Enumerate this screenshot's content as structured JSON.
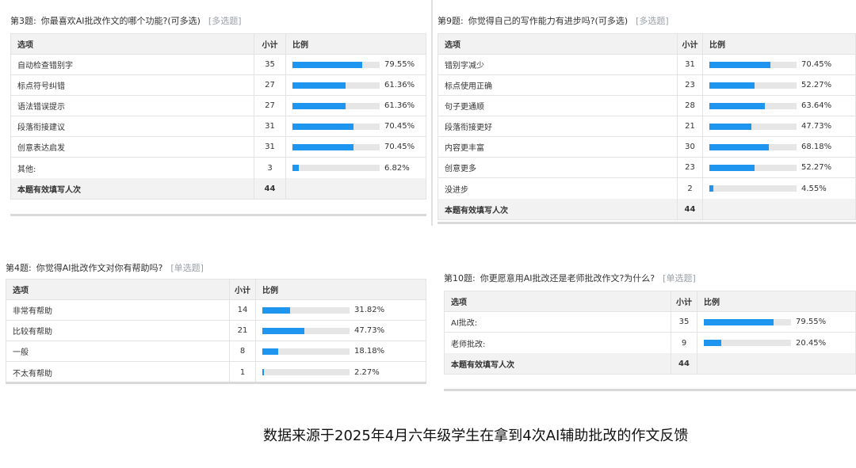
{
  "headers": {
    "option": "选项",
    "count": "小计",
    "ratio": "比例"
  },
  "q3": {
    "number": "第3题:",
    "question": "你最喜欢AI批改作文的哪个功能?(可多选)",
    "type": "[多选题]",
    "rows": [
      {
        "label": "自动检查错别字",
        "count": "35",
        "pct": "79.55%",
        "value": 79.55
      },
      {
        "label": "标点符号纠错",
        "count": "27",
        "pct": "61.36%",
        "value": 61.36
      },
      {
        "label": "语法错误提示",
        "count": "27",
        "pct": "61.36%",
        "value": 61.36
      },
      {
        "label": "段落衔接建议",
        "count": "31",
        "pct": "70.45%",
        "value": 70.45
      },
      {
        "label": "创意表达启发",
        "count": "31",
        "pct": "70.45%",
        "value": 70.45
      },
      {
        "label": "其他:",
        "count": "3",
        "pct": "6.82%",
        "value": 6.82
      }
    ],
    "total_label": "本题有效填写人次",
    "total_count": "44"
  },
  "q9": {
    "number": "第9题:",
    "question": "你觉得自己的写作能力有进步吗?(可多选)",
    "type": "[多选题]",
    "rows": [
      {
        "label": "错别字减少",
        "count": "31",
        "pct": "70.45%",
        "value": 70.45
      },
      {
        "label": "标点使用正确",
        "count": "23",
        "pct": "52.27%",
        "value": 52.27
      },
      {
        "label": "句子更通顺",
        "count": "28",
        "pct": "63.64%",
        "value": 63.64
      },
      {
        "label": "段落衔接更好",
        "count": "21",
        "pct": "47.73%",
        "value": 47.73
      },
      {
        "label": "内容更丰富",
        "count": "30",
        "pct": "68.18%",
        "value": 68.18
      },
      {
        "label": "创意更多",
        "count": "23",
        "pct": "52.27%",
        "value": 52.27
      },
      {
        "label": "没进步",
        "count": "2",
        "pct": "4.55%",
        "value": 4.55
      }
    ],
    "total_label": "本题有效填写人次",
    "total_count": "44"
  },
  "q4": {
    "number": "第4题:",
    "question": "你觉得AI批改作文对你有帮助吗?",
    "type": "[单选题]",
    "rows": [
      {
        "label": "非常有帮助",
        "count": "14",
        "pct": "31.82%",
        "value": 31.82
      },
      {
        "label": "比较有帮助",
        "count": "21",
        "pct": "47.73%",
        "value": 47.73
      },
      {
        "label": "一般",
        "count": "8",
        "pct": "18.18%",
        "value": 18.18
      },
      {
        "label": "不太有帮助",
        "count": "1",
        "pct": "2.27%",
        "value": 2.27
      }
    ]
  },
  "q10": {
    "number": "第10题:",
    "question": "你更愿意用AI批改还是老师批改作文?为什么?",
    "type": "[单选题]",
    "rows": [
      {
        "label": "AI批改:",
        "count": "35",
        "pct": "79.55%",
        "value": 79.55
      },
      {
        "label": "老师批改:",
        "count": "9",
        "pct": "20.45%",
        "value": 20.45
      }
    ],
    "total_label": "本题有效填写人次",
    "total_count": "44"
  },
  "caption": "数据来源于2025年4月六年级学生在拿到4次AI辅助批改的作文反馈",
  "colors": {
    "bar_fill": "#1e96f0",
    "bar_track": "#e6e6e6",
    "header_bg": "#f2f2f2"
  }
}
